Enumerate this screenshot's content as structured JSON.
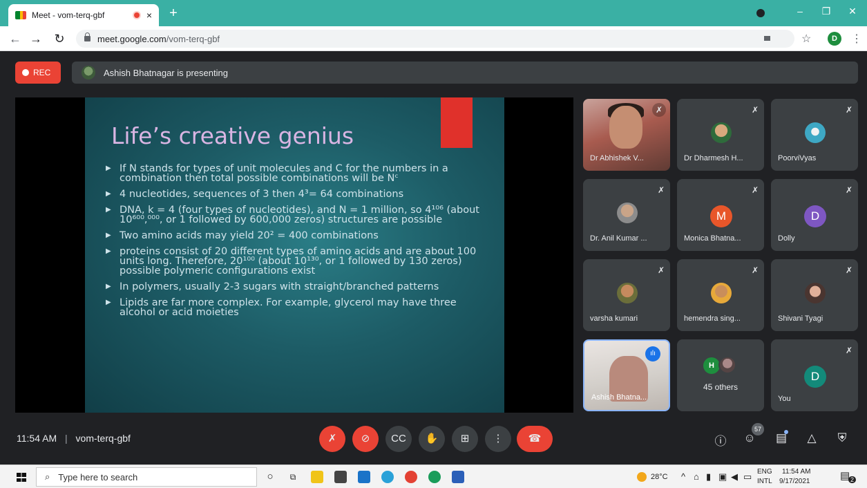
{
  "browser": {
    "tab_title": "Meet - vom-terq-gbf",
    "tab_close": "×",
    "new_tab": "+",
    "url_host": "meet.google.com",
    "url_path": "/vom-terq-gbf",
    "profile_letter": "D",
    "win_minimize": "–",
    "win_restore": "❐",
    "win_close": "✕"
  },
  "meet": {
    "rec_label": "REC",
    "presenting_text": "Ashish Bhatnagar is presenting",
    "time": "11:54 AM",
    "separator": "|",
    "meeting_code": "vom-terq-gbf",
    "participant_count": "57"
  },
  "slide": {
    "title": "Life’s creative genius",
    "bullets": [
      "If N stands for types of unit molecules and C for the numbers in a combination then total possible combinations will be Nᶜ",
      "4 nucleotides, sequences of 3 then 4³= 64 combinations",
      "DNA, k = 4 (four types of nucleotides), and N = 1 million, so 4¹⁰⁶ (about 10⁶⁰⁰,⁰⁰⁰, or 1 followed by 600,000 zeros) structures are possible",
      "Two amino acids may yield 20² = 400 combinations",
      "proteins consist of 20 different types of amino acids and are about 100 units long. Therefore, 20¹⁰⁰ (about 10¹³⁰, or 1 followed by 130 zeros) possible polymeric configurations exist",
      "In polymers, usually 2-3 sugars with straight/branched patterns",
      "Lipids are far more complex. For example, glycerol may have three alcohol or acid moieties"
    ]
  },
  "participants": {
    "p1": "Dr Abhishek V...",
    "p2": "Dr Dharmesh H...",
    "p3": "PoorviVyas",
    "p4": "Dr. Anil Kumar ...",
    "p5": "Monica Bhatna...",
    "p5_letter": "M",
    "p6": "Dolly",
    "p6_letter": "D",
    "p7": "varsha kumari",
    "p8": "hemendra sing...",
    "p9": "Shivani Tyagi",
    "p10": "Ashish Bhatna...",
    "others_letter": "H",
    "others": "45 others",
    "you": "You",
    "you_letter": "D"
  },
  "taskbar": {
    "search_placeholder": "Type here to search",
    "weather": "28°C",
    "lang_top": "ENG",
    "lang_bottom": "INTL",
    "clock_time": "11:54 AM",
    "clock_date": "9/17/2021",
    "notif_count": "2"
  },
  "colors": {
    "tab_strip": "#3ab0a4",
    "meet_bg": "#202124",
    "tile_bg": "#3c4043",
    "red": "#ea4335",
    "slide_title": "#d9b5e3",
    "slide_bg": "#1d5c66"
  },
  "icons": {
    "mic": "mic-off-icon",
    "cam": "camera-off-icon",
    "captions": "captions-icon",
    "hand": "raise-hand-icon",
    "present": "present-icon",
    "more": "more-options-icon",
    "leave": "end-call-icon",
    "info": "info-icon",
    "people": "people-icon",
    "chat": "chat-icon",
    "activities": "activities-icon",
    "host": "host-controls-icon"
  }
}
